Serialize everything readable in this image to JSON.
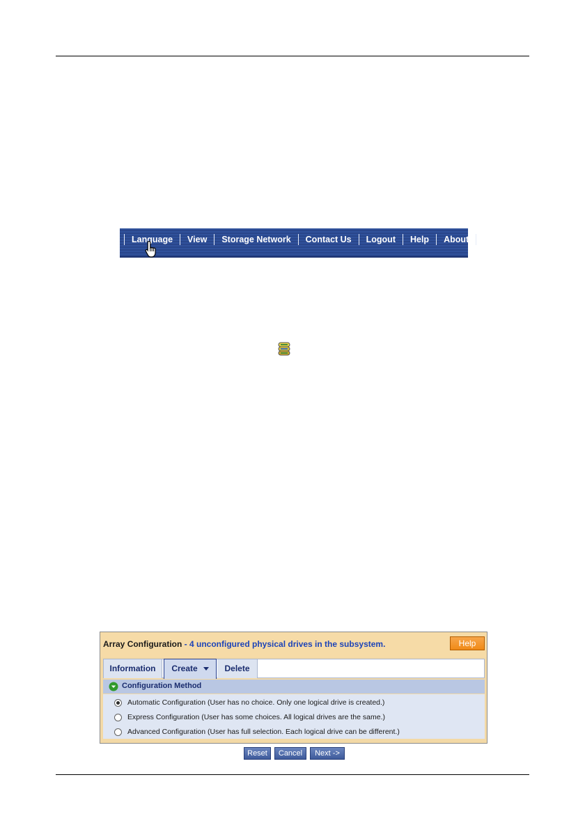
{
  "nav": {
    "items": [
      {
        "label": "Language"
      },
      {
        "label": "View"
      },
      {
        "label": "Storage Network"
      },
      {
        "label": "Contact Us"
      },
      {
        "label": "Logout"
      },
      {
        "label": "Help"
      },
      {
        "label": "About"
      }
    ],
    "bg_color": "#2c4a92"
  },
  "icons": {
    "array": "array-drives-icon",
    "cursor": "hand-pointer-icon"
  },
  "panel": {
    "title": "Array Configuration",
    "subtitle": " - 4 unconfigured physical drives in the subsystem.",
    "help_label": "Help",
    "tabs": [
      {
        "label": "Information"
      },
      {
        "label": "Create",
        "selected": true
      },
      {
        "label": "Delete"
      }
    ],
    "section_title": "Configuration Method",
    "options": [
      {
        "label": "Automatic Configuration (User has no choice. Only one logical drive is created.)",
        "selected": true
      },
      {
        "label": "Express Configuration (User has some choices. All logical drives are the same.)",
        "selected": false
      },
      {
        "label": "Advanced Configuration (User has full selection. Each logical drive can be different.)",
        "selected": false
      }
    ]
  },
  "buttons": {
    "reset": "Reset",
    "cancel": "Cancel",
    "next": "Next ->"
  }
}
